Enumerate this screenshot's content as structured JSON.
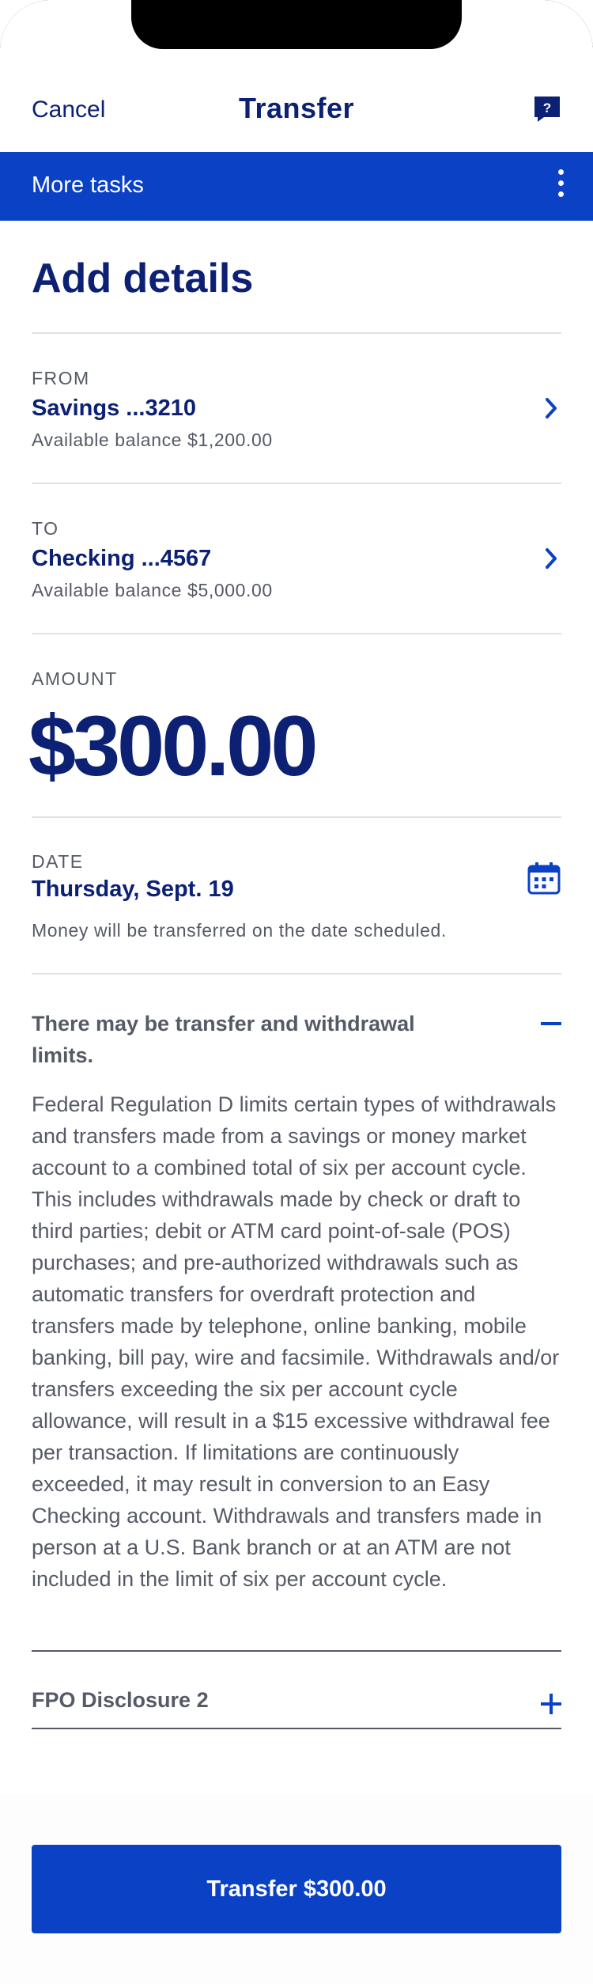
{
  "header": {
    "cancel_label": "Cancel",
    "title": "Transfer",
    "help_icon": "chat-help-icon"
  },
  "tasks_bar": {
    "label": "More tasks",
    "menu_icon": "kebab-menu-icon"
  },
  "section": {
    "title": "Add details"
  },
  "from": {
    "label": "FROM",
    "account": "Savings ...3210",
    "balance": "Available balance $1,200.00"
  },
  "to": {
    "label": "TO",
    "account": "Checking ...4567",
    "balance": "Available balance $5,000.00"
  },
  "amount": {
    "label": "AMOUNT",
    "value": "$300.00"
  },
  "date": {
    "label": "DATE",
    "value": "Thursday, Sept. 19",
    "note": "Money will be transferred on the date scheduled."
  },
  "limits": {
    "title": "There may be transfer and withdrawal limits.",
    "body": "Federal Regulation D limits certain types of withdrawals and transfers made from a savings or money market account to a combined total of six per account cycle. This includes withdrawals made by check or draft to third parties; debit or ATM card point-of-sale (POS) purchases; and pre-authorized withdrawals such as automatic transfers for overdraft protection and transfers made by telephone, online banking, mobile banking, bill pay, wire and facsimile. Withdrawals and/or transfers exceeding the six per account cycle allowance, will result in a $15 excessive withdrawal fee per transaction. If limitations are continuously exceeded, it may result in conversion to an Easy Checking account. Withdrawals and transfers made in person at a U.S. Bank branch or at an ATM are not included in the limit of six per account cycle."
  },
  "disclosure": {
    "label": "FPO Disclosure 2"
  },
  "footer": {
    "button_label": "Transfer $300.00"
  },
  "colors": {
    "brand_blue": "#0a41c5",
    "navy": "#0c2074",
    "gray_text": "#555a66"
  }
}
